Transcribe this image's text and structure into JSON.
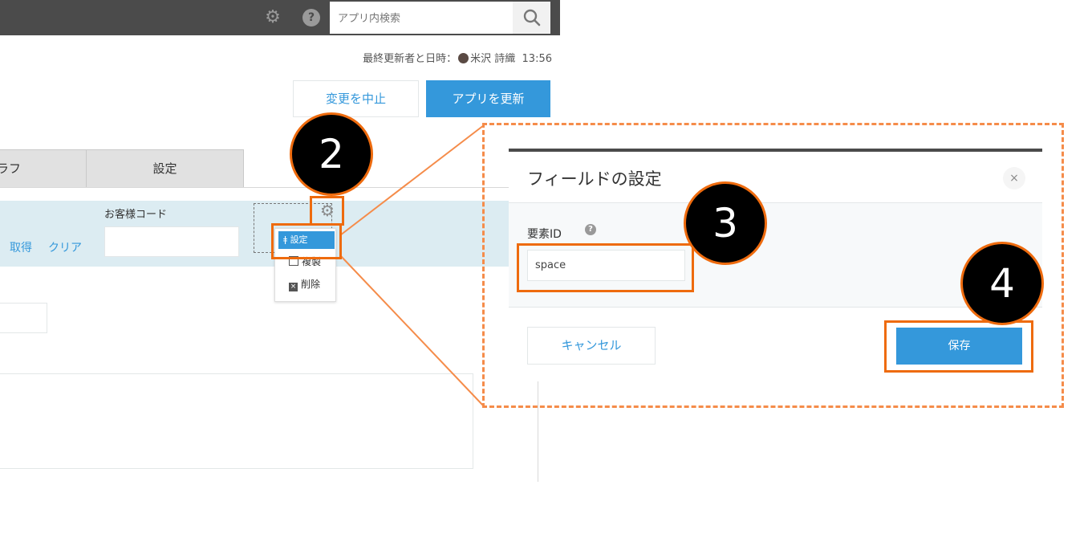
{
  "header": {
    "search_placeholder": "アプリ内検索",
    "settings_icon": "gear-icon",
    "help_icon": "help-icon"
  },
  "status": {
    "last_updated_label": "最終更新者と日時：",
    "user_name": "米沢 詩織",
    "time": "13:56"
  },
  "actions": {
    "cancel_change": "変更を中止",
    "update_app": "アプリを更新"
  },
  "tabs": {
    "graph_partial": "ラフ",
    "settings": "設定"
  },
  "form": {
    "get_link": "取得",
    "clear_link": "クリア",
    "customer_code_label": "お客様コード"
  },
  "context_menu": {
    "settings": "設定",
    "duplicate": "複製",
    "delete": "削除"
  },
  "dialog": {
    "title": "フィールドの設定",
    "close": "×",
    "element_id_label": "要素ID",
    "element_id_value": "space",
    "cancel": "キャンセル",
    "save": "保存"
  },
  "callouts": {
    "step2": "2",
    "step3": "3",
    "step4": "4"
  },
  "colors": {
    "highlight": "#ee6b0e",
    "zoom_dash": "#f58c4a",
    "primary": "#3498db",
    "topbar": "#4b4b4b",
    "form_row_bg": "#dcecf2"
  }
}
